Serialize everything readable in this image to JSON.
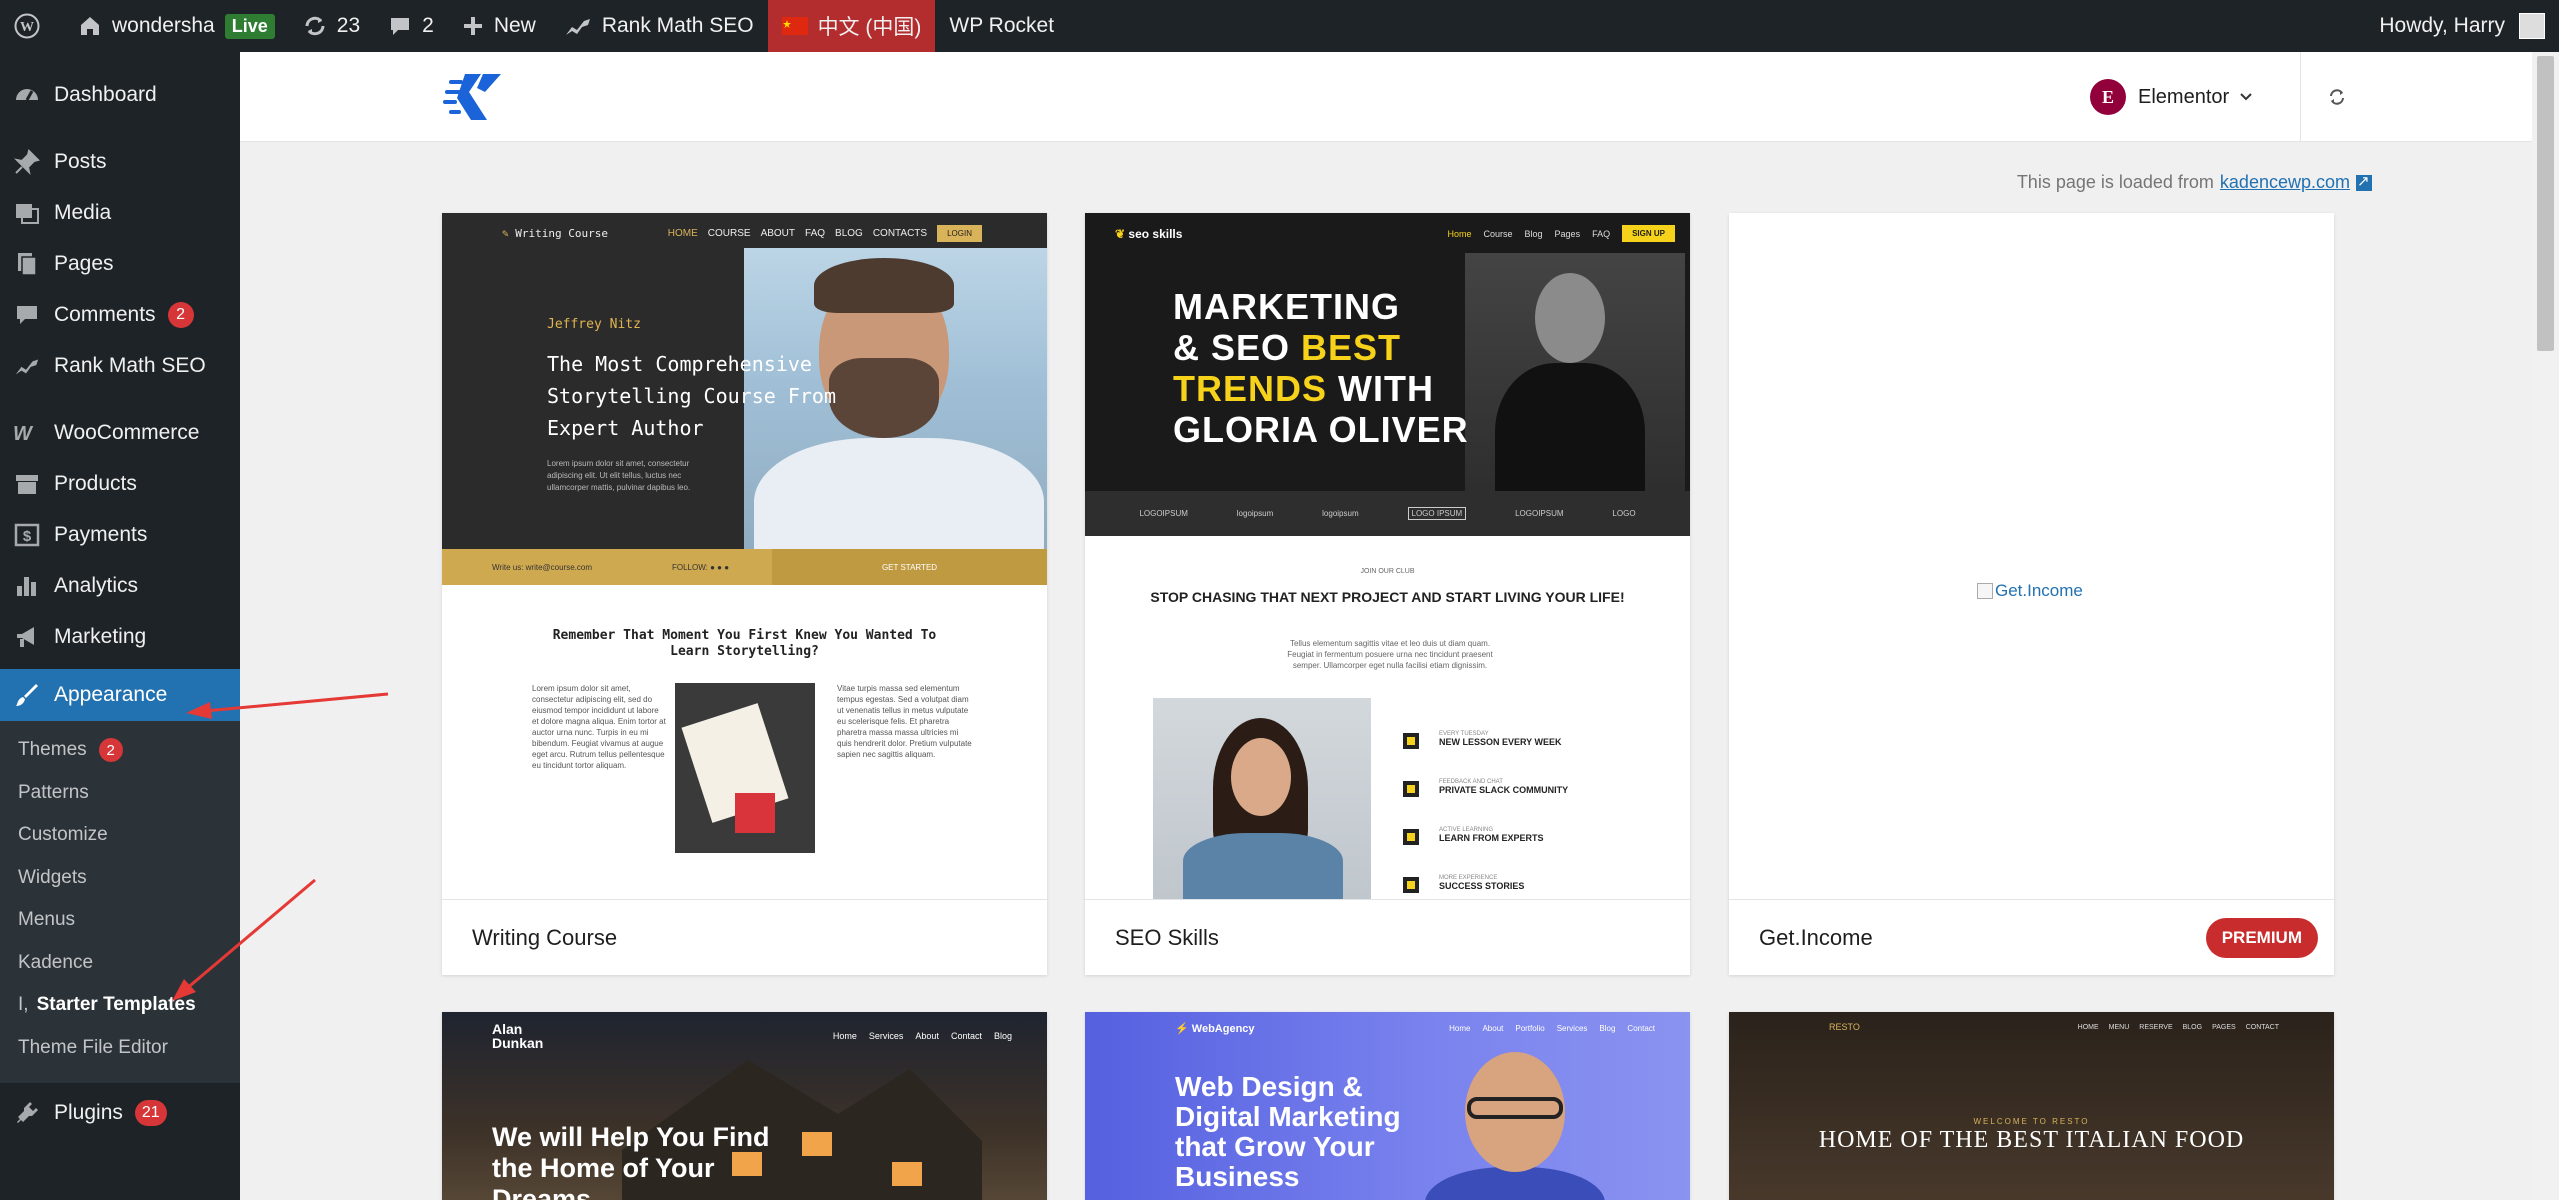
{
  "adminbar": {
    "site_name": "wondersha",
    "live_badge": "Live",
    "updates_count": "23",
    "comments_count": "2",
    "new_label": "New",
    "rankmath_label": "Rank Math SEO",
    "language_label": "中文 (中国)",
    "wprocket_label": "WP Rocket",
    "howdy_label": "Howdy, Harry"
  },
  "sidebar": {
    "items": [
      {
        "label": "Dashboard",
        "icon": "dashboard-icon"
      },
      {
        "label": "Posts",
        "icon": "pin-icon"
      },
      {
        "label": "Media",
        "icon": "media-icon"
      },
      {
        "label": "Pages",
        "icon": "pages-icon"
      },
      {
        "label": "Comments",
        "icon": "comment-icon",
        "count": "2"
      },
      {
        "label": "Rank Math SEO",
        "icon": "chart-icon"
      },
      {
        "label": "WooCommerce",
        "icon": "woo-icon"
      },
      {
        "label": "Products",
        "icon": "archive-icon"
      },
      {
        "label": "Payments",
        "icon": "dollar-icon"
      },
      {
        "label": "Analytics",
        "icon": "bar-chart-icon"
      },
      {
        "label": "Marketing",
        "icon": "megaphone-icon"
      },
      {
        "label": "Appearance",
        "icon": "brush-icon"
      },
      {
        "label": "Plugins",
        "icon": "plugin-icon",
        "count": "21"
      }
    ],
    "appearance_submenu": [
      {
        "label": "Themes",
        "count": "2"
      },
      {
        "label": "Patterns"
      },
      {
        "label": "Customize"
      },
      {
        "label": "Widgets"
      },
      {
        "label": "Menus"
      },
      {
        "label": "Kadence"
      },
      {
        "label": "Starter Templates",
        "prefix": "I,"
      },
      {
        "label": "Theme File Editor"
      }
    ]
  },
  "header": {
    "builder_label": "Elementor",
    "builder_logo_letter": "E"
  },
  "loaded_from": {
    "text": "This page is loaded from",
    "link": "kadencewp.com"
  },
  "cards": [
    {
      "name": "Writing Course",
      "preview": {
        "brand": "Writing Course",
        "nav": [
          "HOME",
          "COURSE",
          "ABOUT",
          "FAQ",
          "BLOG",
          "CONTACTS"
        ],
        "login": "LOGIN",
        "author": "Jeffrey Nitz",
        "title": "The Most Comprehensive Storytelling Course From Expert Author",
        "lorem": "Lorem ipsum dolor sit amet, consectetur adipiscing elit. Ut elit tellus, luctus nec ullamcorper mattis, pulvinar dapibus leo.",
        "write_us": "Write us: write@course.com",
        "follow": "FOLLOW:",
        "get_started": "GET STARTED",
        "heading": "Remember That Moment You First Knew You Wanted To Learn Storytelling?",
        "col1": "Lorem ipsum dolor sit amet, consectetur adipiscing elit, sed do eiusmod tempor incididunt ut labore et dolore magna aliqua. Enim tortor at auctor urna nunc. Turpis in eu mi bibendum. Feugiat vivamus at augue eget arcu. Rutrum tellus pellentesque eu tincidunt tortor aliquam.",
        "col2": "Vitae turpis massa sed elementum tempus egestas. Sed a volutpat diam ut venenatis tellus in metus vulputate eu scelerisque felis. Et pharetra pharetra massa massa ultricies mi quis hendrerit dolor. Pretium vulputate sapien nec sagittis aliquam."
      }
    },
    {
      "name": "SEO Skills",
      "preview": {
        "brand": "seo skills",
        "nav": [
          "Home",
          "Course",
          "Blog",
          "Pages",
          "FAQ"
        ],
        "signup": "SIGN UP",
        "title_white_1": "MARKETING",
        "title_white_2": "& SEO ",
        "title_yellow_1": "BEST",
        "title_yellow_2": "TRENDS",
        "title_white_3": " WITH",
        "title_white_4": "GLORIA OLIVER",
        "logos": [
          "LOGOIPSUM",
          "logoipsum",
          "logoipsum",
          "LOGO IPSUM",
          "LOGOIPSUM",
          "LOGO"
        ],
        "club": "JOIN OUR CLUB",
        "heading": "STOP CHASING THAT NEXT PROJECT AND START LIVING YOUR LIFE!",
        "para": "Tellus elementum sagittis vitae et leo duis ut diam quam. Feugiat in fermentum posuere urna nec tincidunt praesent semper. Ullamcorper eget nulla facilisi etiam dignissim.",
        "features": [
          {
            "small": "EVERY TUESDAY",
            "big": "NEW LESSON EVERY WEEK"
          },
          {
            "small": "FEEDBACK AND CHAT",
            "big": "PRIVATE SLACK COMMUNITY"
          },
          {
            "small": "ACTIVE LEARNING",
            "big": "LEARN FROM EXPERTS"
          },
          {
            "small": "MORE EXPERIENCE",
            "big": "SUCCESS STORIES"
          }
        ]
      }
    },
    {
      "name": "Get.Income",
      "badge": "PREMIUM",
      "alt_text": "Get.Income"
    }
  ],
  "row2": [
    {
      "brand": "Alan Dunkan",
      "nav": [
        "Home",
        "Services",
        "About",
        "Contact",
        "Blog"
      ],
      "hero": "We will Help You Find the Home of Your Dreams"
    },
    {
      "brand": "WebAgency",
      "nav": [
        "Home",
        "About",
        "Portfolio",
        "Services",
        "Blog",
        "Contact"
      ],
      "hero": "Web Design & Digital Marketing that Grow Your Business"
    },
    {
      "brand": "RESTO",
      "nav": [
        "HOME",
        "MENU",
        "RESERVE",
        "BLOG",
        "PAGES",
        "CONTACT"
      ],
      "sub": "WELCOME TO RESTO",
      "hero": "HOME OF THE BEST ITALIAN FOOD"
    }
  ],
  "colors": {
    "admin_dark": "#1d2327",
    "accent_blue": "#2271b1",
    "badge_red": "#d63638",
    "premium_red": "#c92c2c",
    "arrow_red": "#e53935"
  }
}
